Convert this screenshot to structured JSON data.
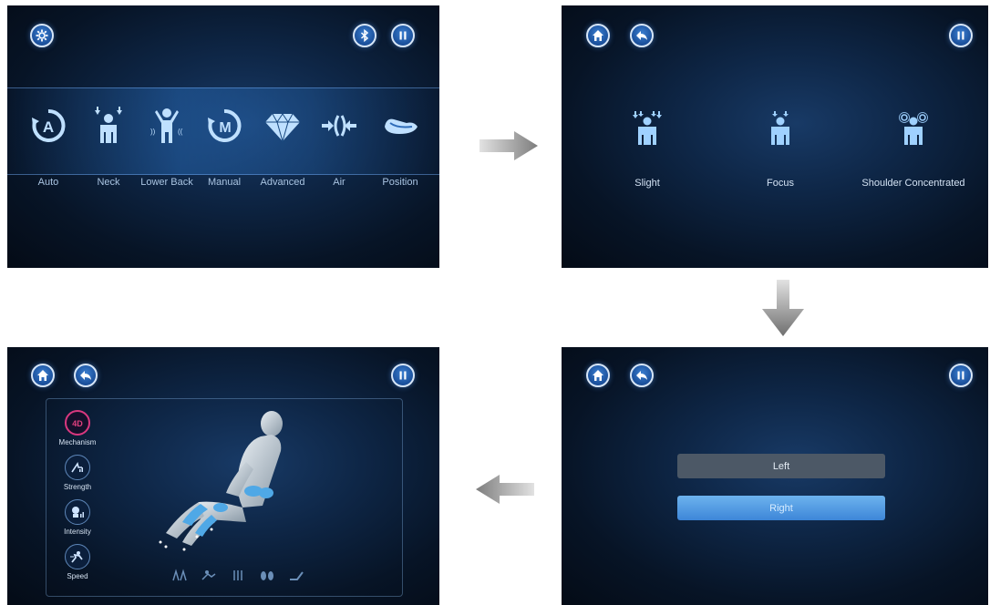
{
  "screen1": {
    "modes": [
      {
        "label": "Auto",
        "icon": "auto-icon"
      },
      {
        "label": "Neck",
        "icon": "neck-icon"
      },
      {
        "label": "Lower Back",
        "icon": "lower-back-icon"
      },
      {
        "label": "Manual",
        "icon": "manual-icon"
      },
      {
        "label": "Advanced",
        "icon": "diamond-icon"
      },
      {
        "label": "Air",
        "icon": "air-icon"
      },
      {
        "label": "Position",
        "icon": "position-icon"
      }
    ],
    "icons": [
      "settings-icon",
      "bluetooth-icon",
      "pause-icon"
    ]
  },
  "screen2": {
    "options": [
      {
        "label": "Slight",
        "icon": "slight-person-icon"
      },
      {
        "label": "Focus",
        "icon": "focus-person-icon"
      },
      {
        "label": "Shoulder Concentrated",
        "icon": "shoulder-person-icon"
      }
    ],
    "icons": [
      "home-icon",
      "back-icon",
      "pause-icon"
    ]
  },
  "screen3": {
    "controls": [
      {
        "label": "Mechanism",
        "icon": "4d-icon",
        "icon_text": "4D",
        "active": true
      },
      {
        "label": "Strength",
        "icon": "strength-icon",
        "active": false
      },
      {
        "label": "Intensity",
        "icon": "intensity-icon",
        "active": false
      },
      {
        "label": "Speed",
        "icon": "speed-icon",
        "active": false
      }
    ],
    "bottom_icons": [
      "shoulder-zone-icon",
      "back-zone-icon",
      "waist-zone-icon",
      "foot-zone-icon",
      "recline-icon"
    ],
    "icons": [
      "home-icon",
      "back-icon",
      "pause-icon"
    ]
  },
  "screen4": {
    "left_label": "Left",
    "right_label": "Right",
    "icons": [
      "home-icon",
      "back-icon",
      "pause-icon"
    ]
  },
  "colors": {
    "panel_bg": "#0b1e38",
    "button_blue": "#2a64b4",
    "accent_pink": "#d9387f",
    "right_button": "#5aa3e8",
    "left_button": "#4c5866",
    "arrow_gray": "#7d7d7d"
  }
}
